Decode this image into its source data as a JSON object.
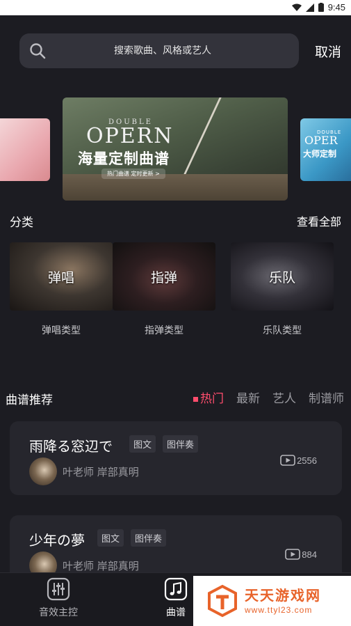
{
  "status_bar": {
    "time": "9:45"
  },
  "search": {
    "placeholder": "搜索歌曲、风格或艺人",
    "cancel_label": "取消"
  },
  "banners": [
    {
      "position": "left"
    },
    {
      "position": "center",
      "small_title": "DOUBLE",
      "title": "OPERN",
      "subtitle": "海量定制曲谱",
      "tag": "热门曲谱 定时更新 >"
    },
    {
      "position": "right",
      "small_title": "DOUBLE",
      "title": "OPER",
      "subtitle": "大师定制"
    }
  ],
  "categories": {
    "title": "分类",
    "view_all": "查看全部",
    "items": [
      {
        "overlay": "弹唱",
        "name": "弹唱类型"
      },
      {
        "overlay": "指弹",
        "name": "指弹类型"
      },
      {
        "overlay": "乐队",
        "name": "乐队类型"
      }
    ]
  },
  "recommend": {
    "title": "曲谱推荐",
    "tabs": [
      {
        "label": "热门",
        "active": true
      },
      {
        "label": "最新",
        "active": false
      },
      {
        "label": "艺人",
        "active": false
      },
      {
        "label": "制谱师",
        "active": false
      }
    ],
    "songs": [
      {
        "title": "雨降る窓辺で",
        "chips": [
          "图文",
          "图伴奏"
        ],
        "artists": "叶老师  岸部真明",
        "plays": "2556"
      },
      {
        "title": "少年の夢",
        "chips": [
          "图文",
          "图伴奏"
        ],
        "artists": "叶老师  岸部真明",
        "plays": "884"
      }
    ]
  },
  "bottom_nav": [
    {
      "label": "音效主控",
      "icon": "mixer-icon"
    },
    {
      "label": "曲谱",
      "icon": "music-note-icon",
      "active": true
    }
  ],
  "watermark": {
    "text": "天天游戏网",
    "url": "www.ttyl23.com"
  },
  "colors": {
    "accent": "#ff4d6d",
    "background": "#1c1c22",
    "card": "#26262d"
  }
}
